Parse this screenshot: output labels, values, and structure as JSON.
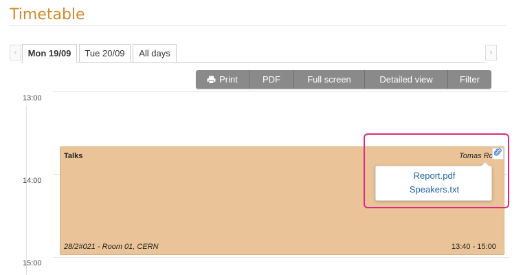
{
  "page": {
    "title": "Timetable"
  },
  "navigation": {
    "prev_arrow": "‹",
    "next_arrow": "›"
  },
  "tabs": [
    {
      "label": "Mon 19/09",
      "active": true
    },
    {
      "label": "Tue 20/09",
      "active": false
    },
    {
      "label": "All days",
      "active": false
    }
  ],
  "toolbar": {
    "print_label": "Print",
    "pdf_label": "PDF",
    "fullscreen_label": "Full screen",
    "detailed_label": "Detailed view",
    "filter_label": "Filter",
    "print_icon": "printer-icon"
  },
  "timeline": {
    "hours": [
      "13:00",
      "14:00",
      "15:00"
    ]
  },
  "event": {
    "title": "Talks",
    "speaker": "Tomas Ro",
    "location": "28/2#021 - Room 01, CERN",
    "time": "13:40 - 15:00",
    "color": "#eac498",
    "attachment_icon": "paperclip-icon"
  },
  "attachments": {
    "files": [
      "Report.pdf",
      "Speakers.txt"
    ]
  },
  "colors": {
    "title": "#d08a2e",
    "toolbar": "#8a8a8a",
    "link": "#1c63a4",
    "highlight": "#e0297e"
  }
}
